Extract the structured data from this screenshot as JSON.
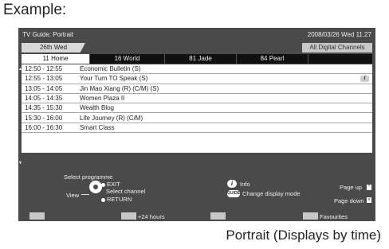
{
  "page": {
    "heading": "Example:",
    "caption": "Portrait (Displays by time)"
  },
  "tv": {
    "title": "TV Guide: Portrait",
    "datetime": "2008/03/26 Wed 11:27",
    "date_tab": "26th Wed",
    "all_channels": "All Digital Channels",
    "channels": [
      {
        "label": "11 Home",
        "active": true
      },
      {
        "label": "16 World",
        "active": false
      },
      {
        "label": "81 Jade",
        "active": false
      },
      {
        "label": "84 Pearl",
        "active": false
      }
    ],
    "programmes": [
      {
        "time": "12:50 - 12:55",
        "title": "Economic Bulletin (S)",
        "info": ""
      },
      {
        "time": "12:55 - 13:05",
        "title": "Your Turn TO Speak (S)",
        "info": "i"
      },
      {
        "time": "13:05 - 14:05",
        "title": "Jin Mao Xiang (R) (C/M) (S)",
        "info": ""
      },
      {
        "time": "14:05 - 14:35",
        "title": "Women Plaza II",
        "info": ""
      },
      {
        "time": "14:35 - 15:30",
        "title": "Wealth Blog",
        "info": ""
      },
      {
        "time": "15:30 - 16:00",
        "title": "Life Journey (R) (C/M)",
        "info": ""
      },
      {
        "time": "16:00 - 16:30",
        "title": "Smart Class",
        "info": ""
      }
    ],
    "help": {
      "select_programme": "Select programme",
      "exit": "EXIT",
      "select_channel": "Select channel",
      "view": "View",
      "return": "RETURN",
      "info": "Info",
      "info_key": "i",
      "guide_key": "GUIDE",
      "change_display_mode": "Change display mode",
      "page_up": "Page up",
      "page_down": "Page down",
      "up_glyph": "^",
      "down_glyph": "v"
    },
    "color_keys": {
      "red": "",
      "green": "+24 hours",
      "yellow": "",
      "blue": "Favourites"
    },
    "scroll_up_glyph": "▲",
    "scroll_down_glyph": "▼"
  }
}
